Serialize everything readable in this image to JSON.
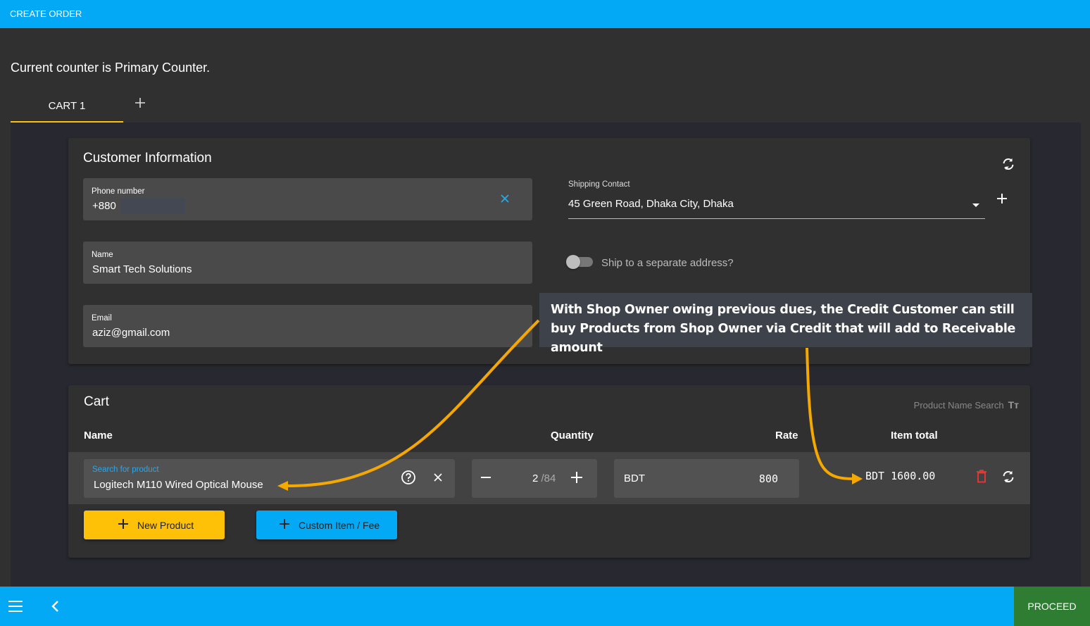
{
  "topbar": {
    "title": "CREATE ORDER"
  },
  "counter_text": "Current counter is Primary Counter.",
  "tabs": [
    {
      "label": "CART 1",
      "active": true
    }
  ],
  "customer": {
    "title": "Customer Information",
    "phone": {
      "label": "Phone number",
      "value": "+880"
    },
    "name": {
      "label": "Name",
      "value": "Smart Tech Solutions"
    },
    "email": {
      "label": "Email",
      "value": "aziz@gmail.com"
    },
    "shipping": {
      "label": "Shipping Contact",
      "value": "45 Green Road, Dhaka City, Dhaka"
    },
    "ship_separate": {
      "label": "Ship to a separate address?",
      "checked": false
    }
  },
  "cart": {
    "title": "Cart",
    "search_mode": {
      "label": "Product Name Search",
      "icon": "Tт"
    },
    "columns": {
      "name": "Name",
      "quantity": "Quantity",
      "rate": "Rate",
      "item_total": "Item total"
    },
    "items": [
      {
        "search_label": "Search for product",
        "product": "Logitech M110 Wired Optical Mouse",
        "quantity": "2",
        "stock": "/84",
        "currency": "BDT",
        "rate": "800",
        "item_total": "BDT 1600.00"
      }
    ],
    "new_product_label": "New Product",
    "custom_item_label": "Custom Item / Fee"
  },
  "callout": {
    "text": "With Shop Owner owing previous dues, the Credit Customer can still buy Products from Shop Owner via Credit that will add to Receivable amount"
  },
  "bottombar": {
    "proceed_label": "PROCEED"
  },
  "colors": {
    "primary": "#03a9f4",
    "accent": "#ffc107",
    "proceed": "#2e7d32",
    "delete": "#e53935",
    "annotation_arrow": "#f5a800"
  }
}
